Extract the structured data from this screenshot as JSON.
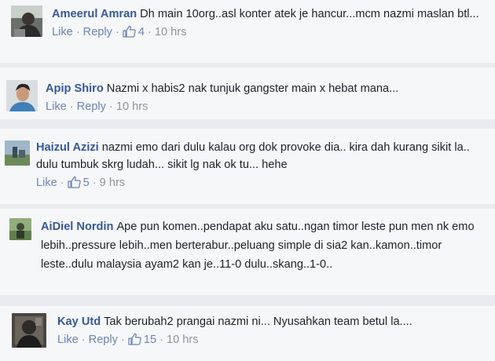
{
  "comments": [
    {
      "author": "Ameerul Amran",
      "text": "Dh main 10org..asl konter atek je hancur...mcm nazmi maslan btl...",
      "like_label": "Like",
      "reply_label": "Reply",
      "like_count": "4",
      "time": "10 hrs"
    },
    {
      "author": "Apip Shiro",
      "text": "Nazmi x habis2 nak tunjuk gangster main x hebat mana...",
      "like_label": "Like",
      "reply_label": "Reply",
      "like_count": "",
      "time": "10 hrs"
    },
    {
      "author": "Haizul Azizi",
      "text": "nazmi emo dari dulu kalau org dok provoke dia.. kira dah kurang sikit la.. dulu tumbuk skrg ludah... sikit lg nak ok tu... hehe",
      "like_label": "Like",
      "reply_label": "",
      "like_count": "5",
      "time": "9 hrs"
    },
    {
      "author": "AiDiel Nordin",
      "text": "Ape pun komen..pendapat aku satu..ngan timor leste pun men nk emo lebih..pressure lebih..men berterabur..peluang simple di sia2 kan..kamon..timor leste..dulu malaysia ayam2 kan je..11-0 dulu..skang..1-0..",
      "like_label": "",
      "reply_label": "",
      "like_count": "",
      "time": ""
    },
    {
      "author": "Kay Utd",
      "text": "Tak berubah2 prangai nazmi ni... Nyusahkan team betul la....",
      "like_label": "Like",
      "reply_label": "Reply",
      "like_count": "15",
      "time": "10 hrs"
    }
  ],
  "colors": {
    "background": "#e9ebee",
    "card": "#f6f7f9",
    "author": "#365899",
    "link": "#6d84b4",
    "meta": "#90949c",
    "text": "#1d2129"
  },
  "icons": {
    "like": "thumbs-up-icon"
  }
}
